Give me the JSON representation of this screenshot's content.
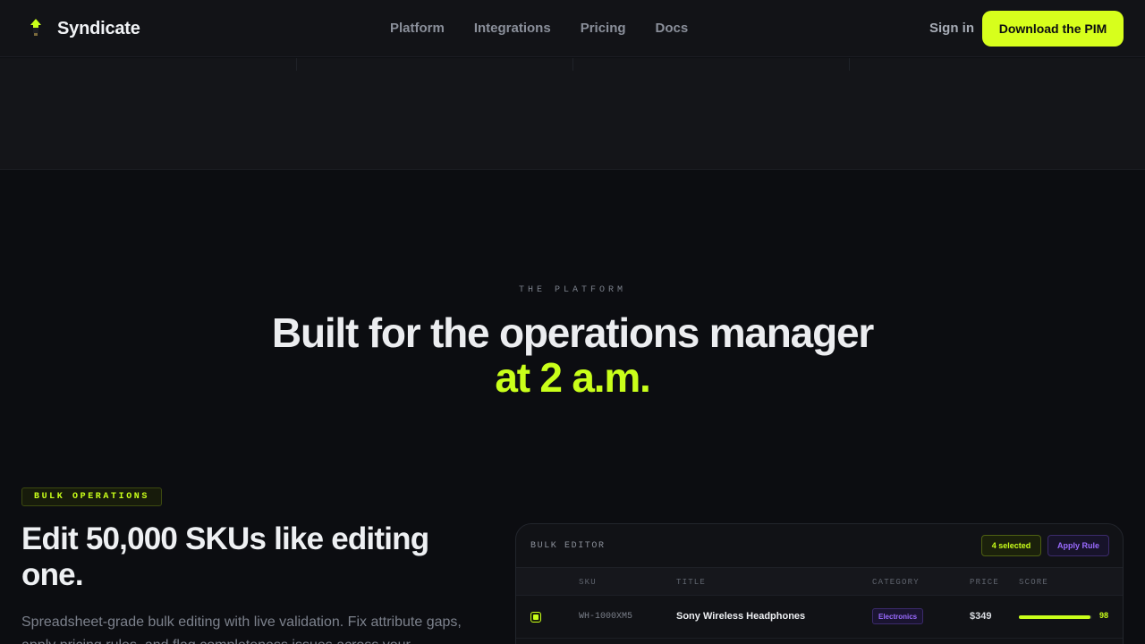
{
  "nav": {
    "brand": "Syndicate",
    "links": [
      "Platform",
      "Integrations",
      "Pricing",
      "Docs"
    ],
    "signin": "Sign in",
    "cta": "Download the PIM"
  },
  "hero": {
    "eyebrow": "THE PLATFORM",
    "headline": "Built for the operations manager",
    "headline_accent": "at 2 a.m."
  },
  "section": {
    "pill": "BULK OPERATIONS",
    "title": "Edit 50,000 SKUs like editing one.",
    "body": "Spreadsheet-grade bulk editing with live validation. Fix attribute gaps, apply pricing rules, and flag completeness issues across your"
  },
  "editor": {
    "title": "BULK EDITOR",
    "selected": "4 selected",
    "apply_rule": "Apply Rule",
    "columns": [
      "SKU",
      "TITLE",
      "CATEGORY",
      "PRICE",
      "SCORE"
    ],
    "rows": [
      {
        "sku": "WH-1000XM5",
        "title": "Sony Wireless Headphones",
        "category": "Electronics",
        "price": "$349",
        "score": "98",
        "score_value": 98,
        "selected": true
      }
    ]
  },
  "colors": {
    "accent": "#c9ff1a",
    "purple": "#9a6bff",
    "background": "#0c0d11"
  }
}
